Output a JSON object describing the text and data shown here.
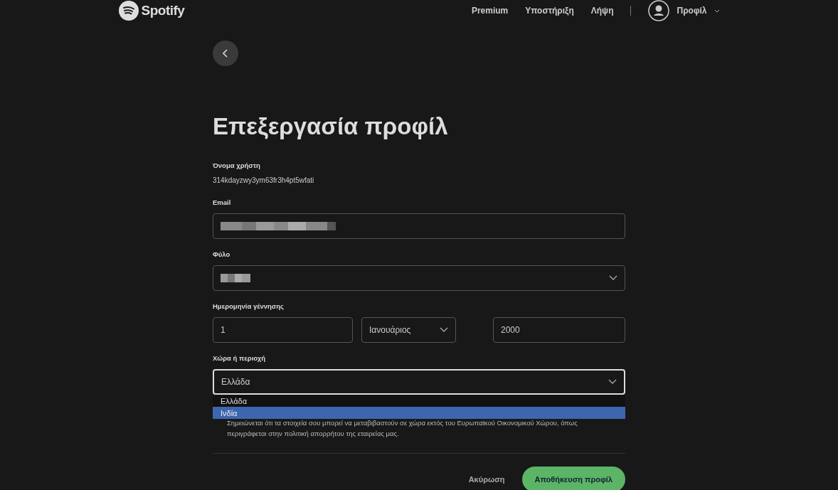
{
  "header": {
    "brand": "Spotify",
    "nav": [
      "Premium",
      "Υποστήριξη",
      "Λήψη"
    ],
    "profile": "Προφίλ"
  },
  "title": "Επεξεργασία προφίλ",
  "username": {
    "label": "Όνομα χρήστη",
    "value": "314kdayzwy3ym63fr3h4pt5wfati"
  },
  "email": {
    "label": "Email",
    "redacted": true
  },
  "gender": {
    "label": "Φύλο",
    "redacted": true
  },
  "birthdate": {
    "label": "Ημερομηνία γέννησης",
    "day": "1",
    "month": "Ιανουάριος",
    "year": "2000"
  },
  "country": {
    "label": "Χώρα ή περιοχή",
    "value": "Ελλάδα",
    "expanded": true,
    "options": [
      {
        "label": "Ελλάδα",
        "highlighted": false
      },
      {
        "label": "Ινδία",
        "highlighted": true
      }
    ]
  },
  "note": "Σημειώνεται ότι τα στοιχεία σου μπορεί να μεταβιβαστούν σε χώρα εκτός του Ευρωπαϊκού Οικονομικού Χώρου, όπως περιγράφεται στην πολιτική απορρήτου της εταιρείας μας.",
  "buttons": {
    "cancel": "Ακύρωση",
    "save": "Αποθήκευση προφίλ"
  }
}
